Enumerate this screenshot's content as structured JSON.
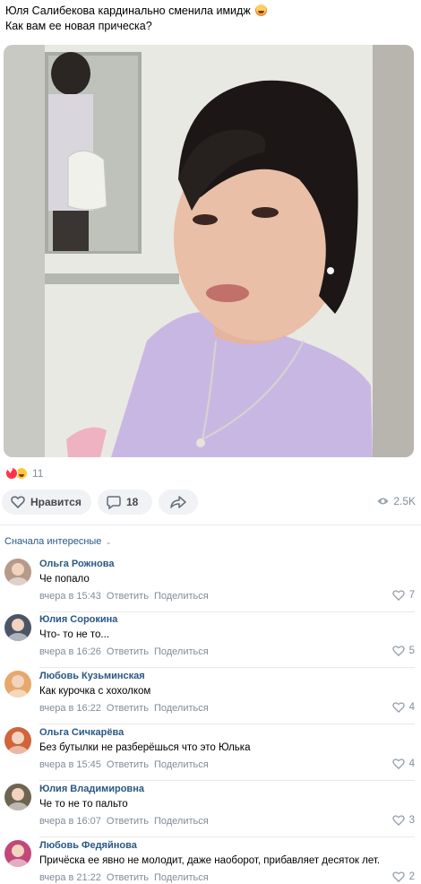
{
  "post": {
    "line1": "Юля Салибекова кардинально сменила имидж",
    "line2": "Как вам ее новая прическа?"
  },
  "reactions": {
    "count": "11"
  },
  "actions": {
    "like_label": "Нравится",
    "comments_count": "18",
    "views": "2.5K"
  },
  "comments_section": {
    "sort_label": "Сначала интересные"
  },
  "comments": [
    {
      "author": "Ольга Рожнова",
      "text": "Че попало",
      "time": "вчера в 15:43",
      "reply": "Ответить",
      "share": "Поделиться",
      "likes": "7",
      "avatar_color": "#b89a8a"
    },
    {
      "author": "Юлия Сорокина",
      "text": "Что- то не то...",
      "time": "вчера в 16:26",
      "reply": "Ответить",
      "share": "Поделиться",
      "likes": "5",
      "avatar_color": "#4c5566"
    },
    {
      "author": "Любовь Кузьминская",
      "text": "Как курочка с хохолком",
      "time": "вчера в 16:22",
      "reply": "Ответить",
      "share": "Поделиться",
      "likes": "4",
      "avatar_color": "#e6a86b"
    },
    {
      "author": "Ольга Сичкарёва",
      "text": "Без бутылки не разберёшься что это Юлька",
      "time": "вчера в 15:45",
      "reply": "Ответить",
      "share": "Поделиться",
      "likes": "4",
      "avatar_color": "#d0643a"
    },
    {
      "author": "Юлия Владимировна",
      "text": "Че то не то пальто",
      "time": "вчера в 16:07",
      "reply": "Ответить",
      "share": "Поделиться",
      "likes": "3",
      "avatar_color": "#6d6452"
    },
    {
      "author": "Любовь Федяйнова",
      "text": "Причёска ее явно не молодит, даже наоборот, прибавляет десяток лет.",
      "time": "вчера в 21:22",
      "reply": "Ответить",
      "share": "Поделиться",
      "likes": "2",
      "avatar_color": "#c2487a"
    }
  ]
}
